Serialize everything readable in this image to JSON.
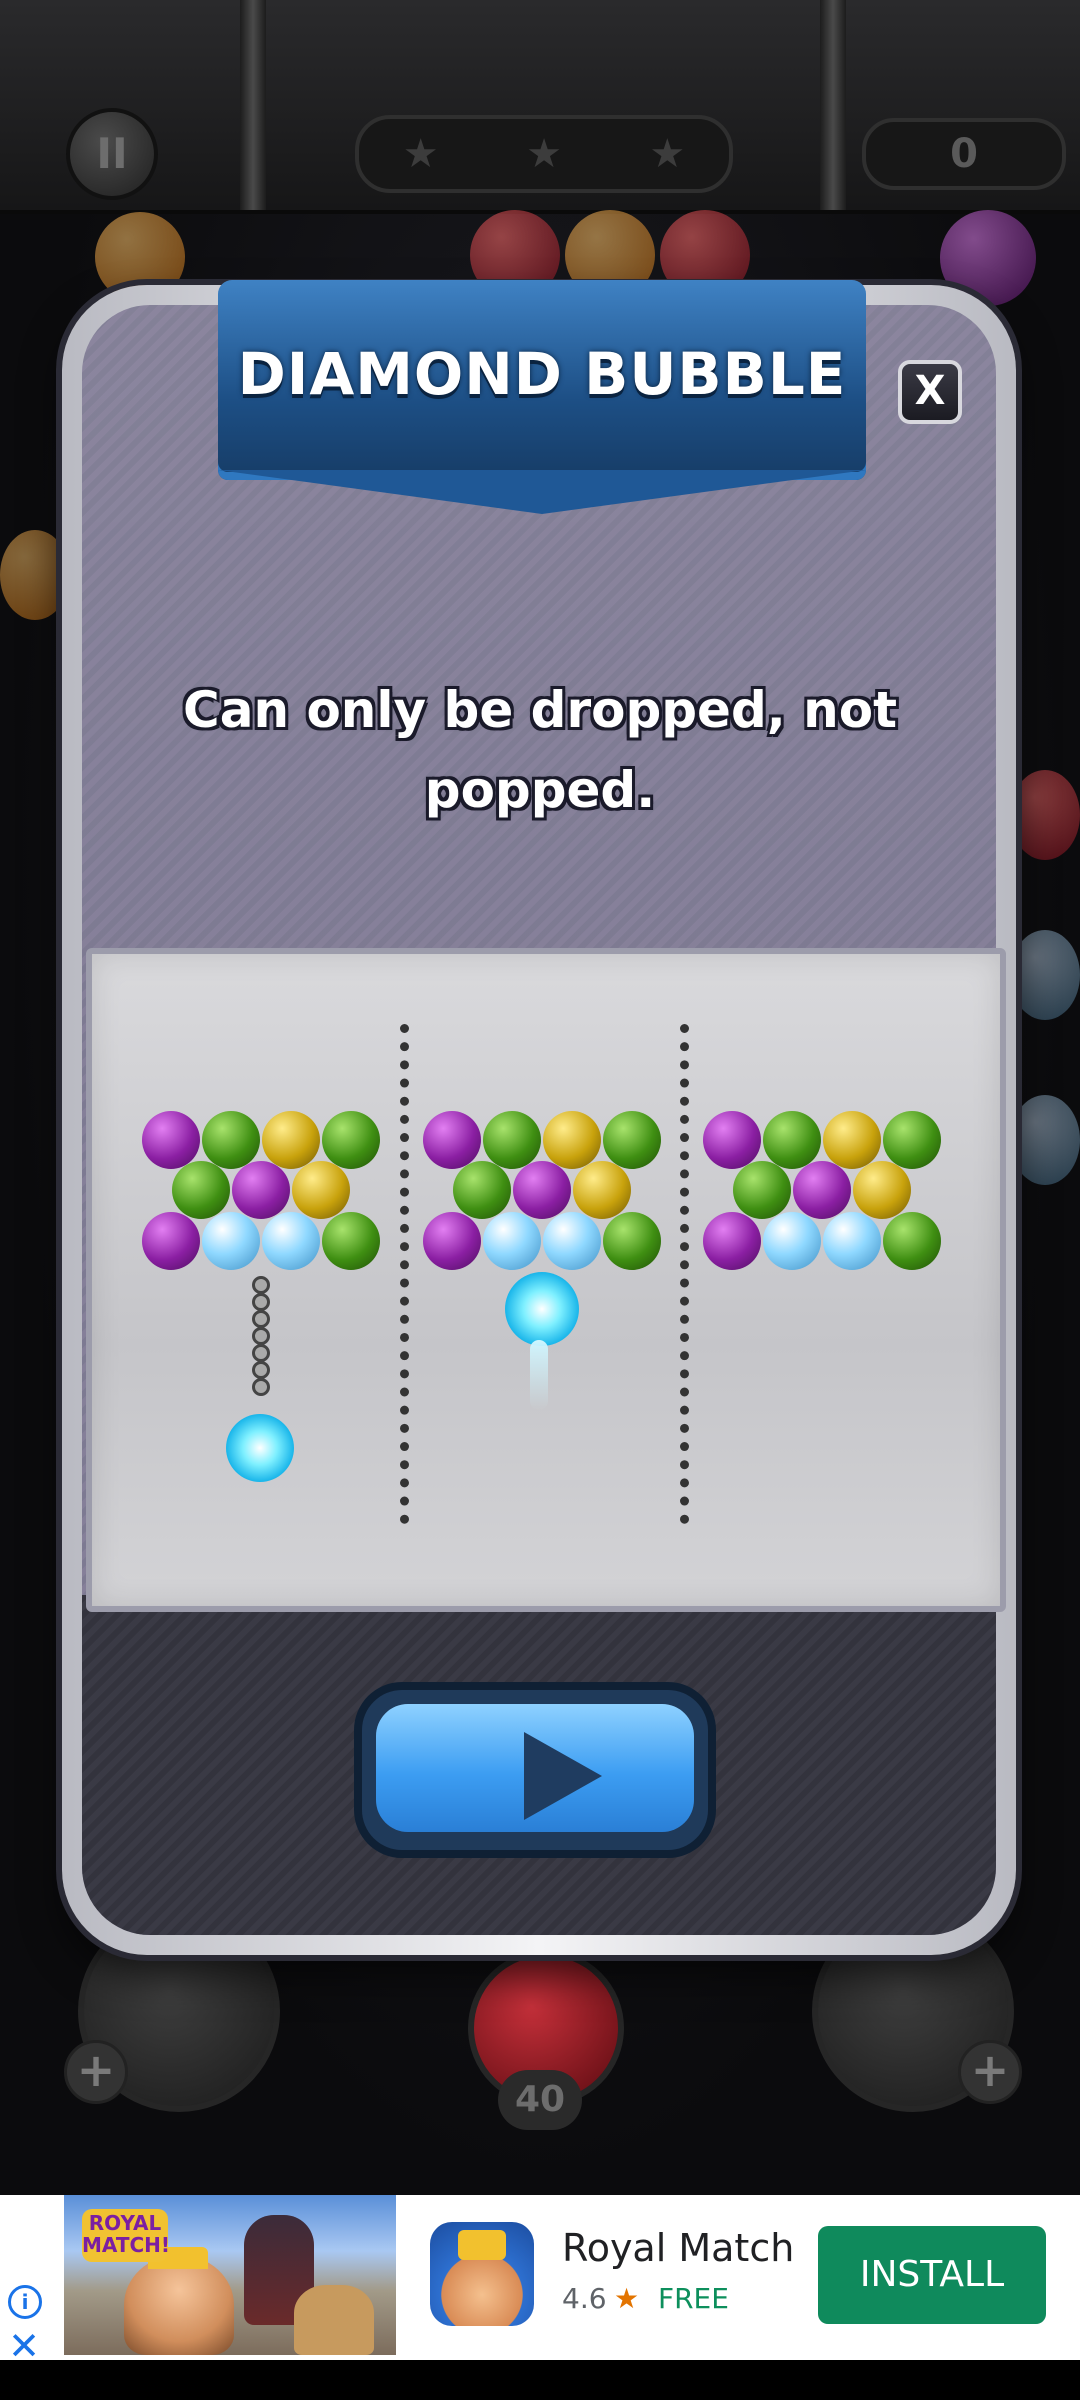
{
  "hud": {
    "pause_icon": "pause-icon",
    "stars": [
      "★",
      "★",
      "★"
    ],
    "score": "0",
    "shots_left": "40",
    "plus_left": "+",
    "plus_right": "+"
  },
  "modal": {
    "title": "DIAMOND BUBBLE",
    "close_label": "X",
    "description_line1": "Can only be dropped, not",
    "description_line2": "popped.",
    "play_icon": "play-icon"
  },
  "ad": {
    "brand_logo": "ROYAL MATCH!",
    "app_name": "Royal Match",
    "rating": "4.6",
    "rating_star": "★",
    "price": "FREE",
    "install_label": "INSTALL",
    "info_icon": "i",
    "close_icon": "✕"
  },
  "colors": {
    "banner_blue": "#1d4f85",
    "play_button_blue": "#3c9df2",
    "install_green": "#0f8a5c",
    "bubble_purple": "#8b1fa3",
    "bubble_green": "#3f8f12",
    "bubble_yellow": "#c8a20c",
    "bubble_diamond": "#8fd8ff"
  }
}
